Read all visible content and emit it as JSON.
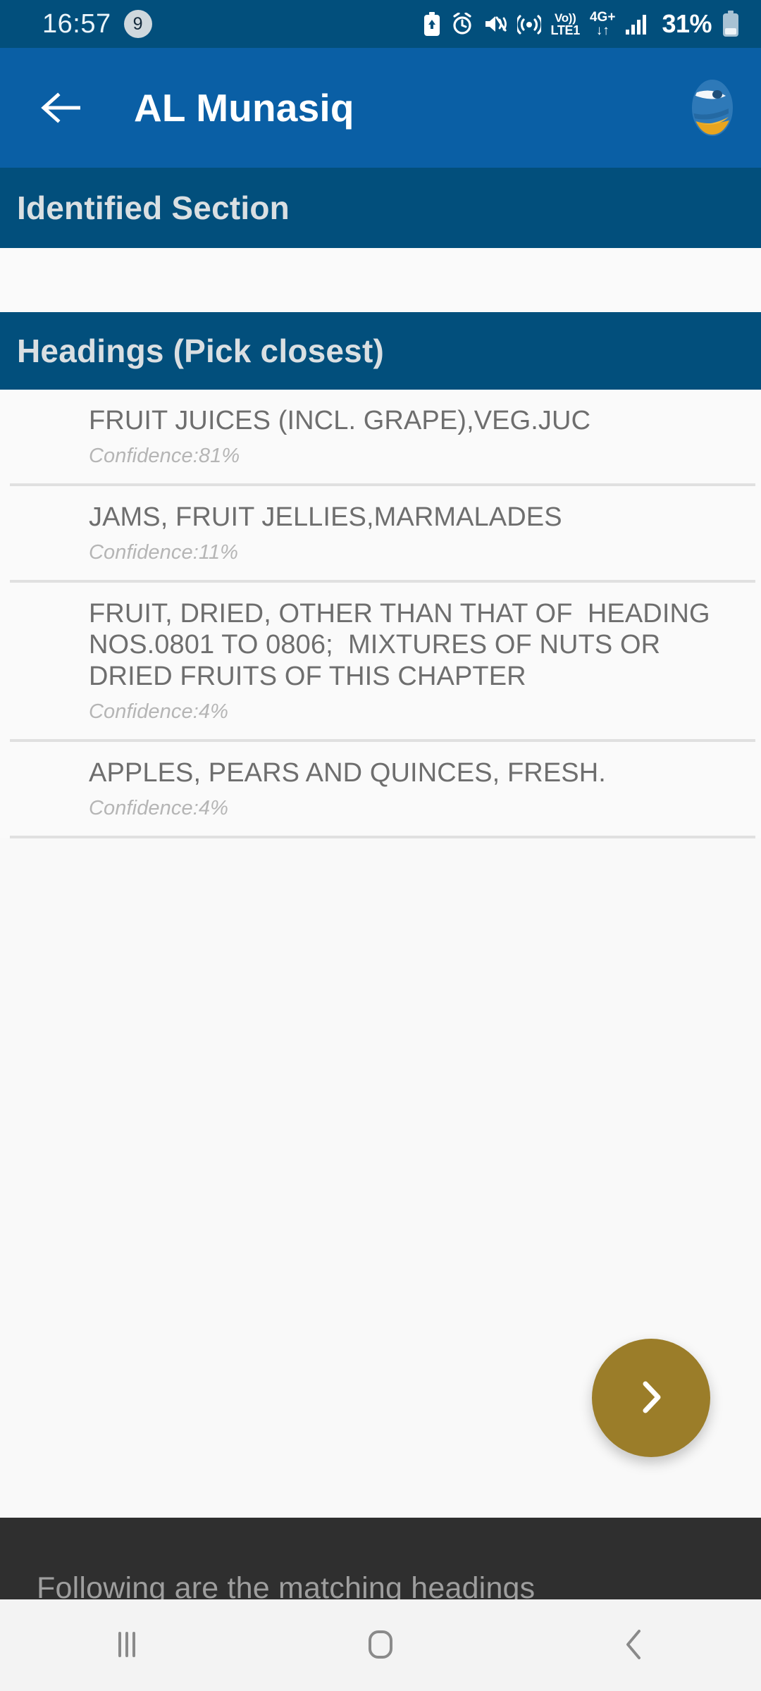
{
  "status_bar": {
    "time": "16:57",
    "notification_count": "9",
    "network_top": "Vo))",
    "network_bottom": "LTE1",
    "mobile_data_label": "4G+",
    "mobile_data_arrows": "↓↑",
    "battery_percent": "31%",
    "icons": [
      "battery-saver-icon",
      "alarm-icon",
      "mute-vibrate-icon",
      "hotspot-icon",
      "volte-icon",
      "mobile-data-icon",
      "signal-bars-icon",
      "battery-icon"
    ],
    "background_color": "#024F7C"
  },
  "app_bar": {
    "back_label": "back-arrow",
    "title": "AL Munasiq",
    "logo_name": "al-munasiq-globe-logo",
    "background_color": "#0A5FA5"
  },
  "identified_section": {
    "title": "Identified Section",
    "value": "",
    "background_color": "#024F7C"
  },
  "headings_section": {
    "title": "Headings (Pick closest)",
    "background_color": "#024F7C",
    "items": [
      {
        "title": "FRUIT JUICES (INCL. GRAPE),VEG.JUC",
        "confidence": "Confidence:81%",
        "confidence_value": 81
      },
      {
        "title": "JAMS, FRUIT JELLIES,MARMALADES",
        "confidence": "Confidence:11%",
        "confidence_value": 11
      },
      {
        "title": "FRUIT, DRIED, OTHER THAN THAT OF  HEADING NOS.0801 TO 0806;  MIXTURES OF NUTS OR DRIED FRUITS OF THIS CHAPTER",
        "confidence": "Confidence:4%",
        "confidence_value": 4
      },
      {
        "title": "APPLES, PEARS AND QUINCES, FRESH.",
        "confidence": "Confidence:4%",
        "confidence_value": 4
      }
    ]
  },
  "fab": {
    "icon": "chevron-right-icon",
    "color": "#9B7D29"
  },
  "toast": {
    "message": "Following are the matching headings",
    "background_color": "#2F2F2F"
  },
  "nav_bar": {
    "recents_label": "recents-button",
    "home_label": "home-button",
    "back_label": "back-button",
    "background_color": "#F3F3F3"
  }
}
